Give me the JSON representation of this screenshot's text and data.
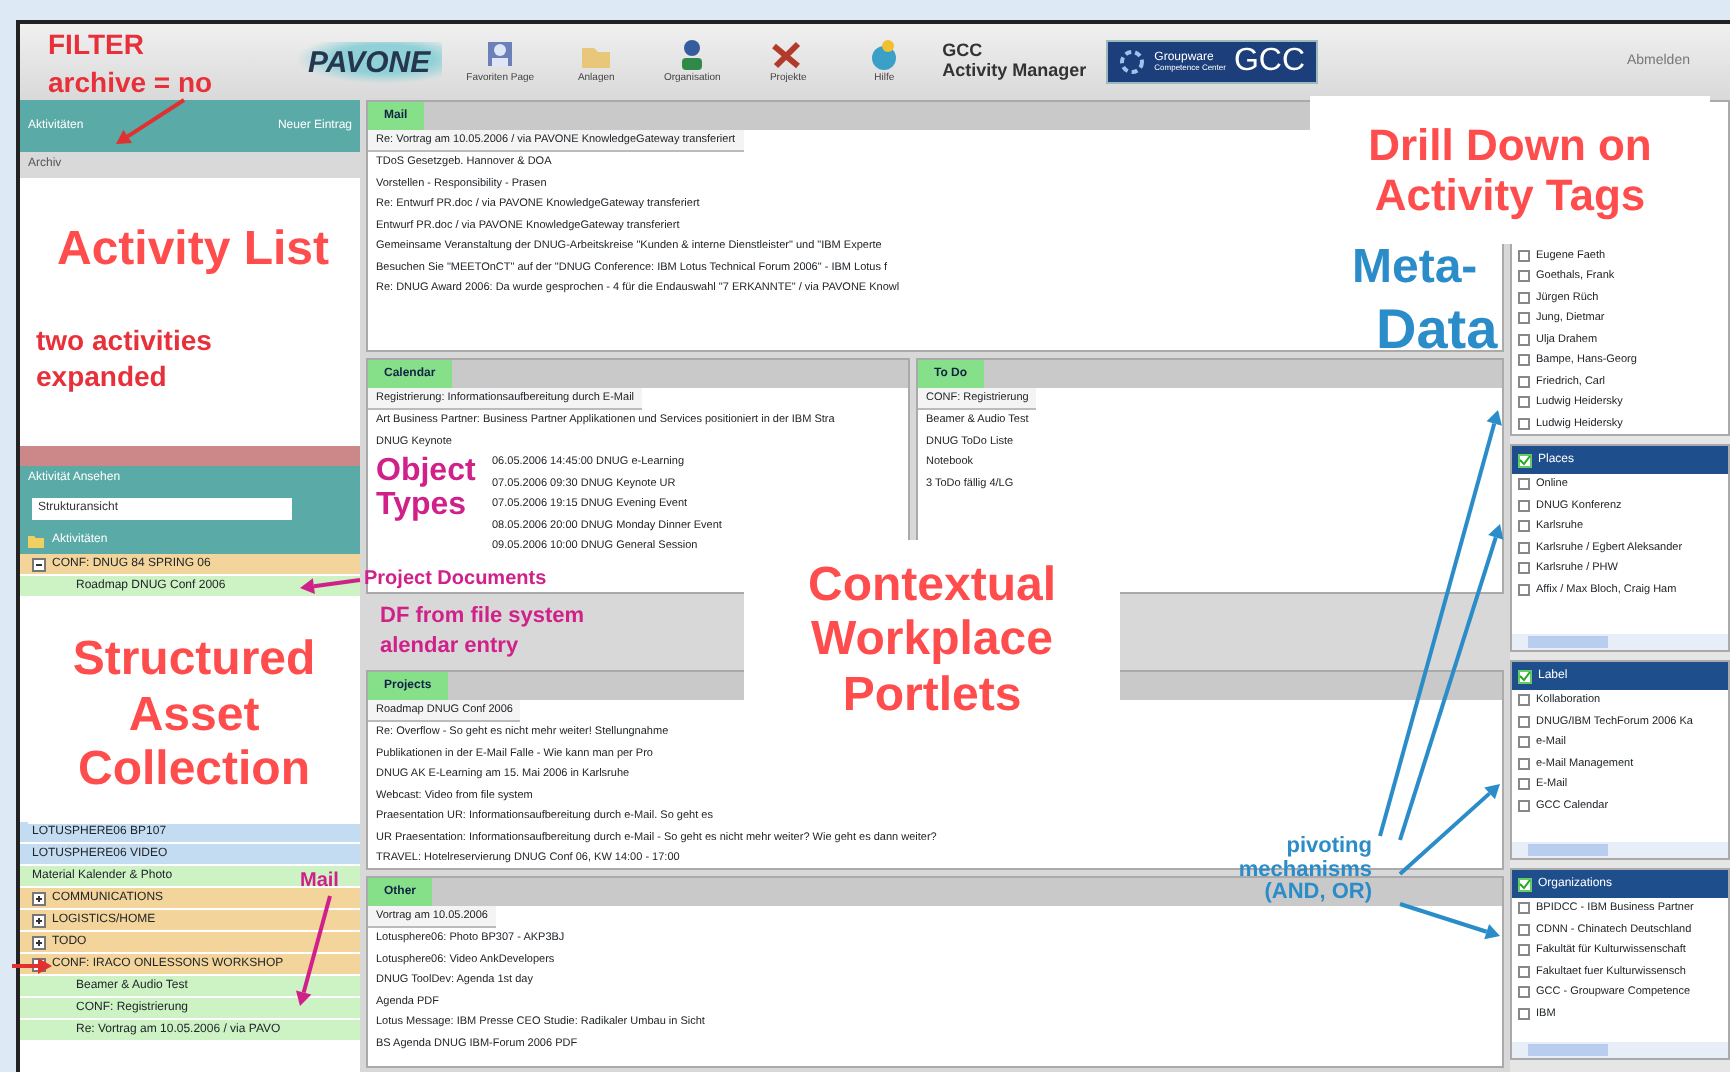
{
  "header": {
    "logo": "PAVONE",
    "toolbar": [
      {
        "label": "Favoriten Page"
      },
      {
        "label": "Anlagen"
      },
      {
        "label": "Organisation"
      },
      {
        "label": "Projekte"
      },
      {
        "label": "Hilfe"
      }
    ],
    "app_title": [
      "GCC",
      "Activity Manager"
    ],
    "banner": {
      "text": "Groupware",
      "sub": "Competence Center",
      "mark": "GCC"
    },
    "logout": "Abmelden"
  },
  "sidebar": {
    "list_header": "Aktivitäten",
    "list_action": "Neuer Eintrag",
    "filter": "Archiv",
    "view_header": "Aktivität Ansehen",
    "view_select": "Strukturansicht",
    "folder": "Aktivitäten",
    "tree": [
      {
        "text": "CONF: DNUG 84 SPRING 06",
        "color": "#f3d49a",
        "expanded": true,
        "children": [
          {
            "text": "Roadmap DNUG Conf 2006",
            "color": "#cdf2c4"
          }
        ]
      },
      {
        "text": "LOTUSPHERE06 BP107",
        "color": "#c4dcf2"
      },
      {
        "text": "LOTUSPHERE06 VIDEO",
        "color": "#c4dcf2"
      },
      {
        "text": "Material Kalender & Photo",
        "color": "#cdf2c4"
      },
      {
        "text": "COMMUNICATIONS",
        "color": "#f3d49a",
        "expanded": false
      },
      {
        "text": "LOGISTICS/HOME",
        "color": "#f3d49a",
        "expanded": false
      },
      {
        "text": "TODO",
        "color": "#f3d49a",
        "expanded": false
      },
      {
        "text": "CONF: IRACO ONLESSONS WORKSHOP",
        "color": "#f3d49a",
        "expanded": true,
        "children": [
          {
            "text": "Beamer & Audio Test",
            "color": "#cdf2c4"
          },
          {
            "text": "CONF: Registrierung",
            "color": "#cdf2c4"
          },
          {
            "text": "Re: Vortrag am 10.05.2006 / via PAVO",
            "color": "#cdf2c4"
          }
        ]
      }
    ]
  },
  "portlets": [
    {
      "title": "Mail",
      "subtitle": "Re: Vortrag am 10.05.2006 / via PAVONE KnowledgeGateway transferiert",
      "lines": [
        "TDoS Gesetzgeb. Hannover & DOA",
        "Vorstellen - Responsibility - Prasen",
        "Re: Entwurf PR.doc / via PAVONE KnowledgeGateway transferiert",
        "Entwurf PR.doc / via PAVONE KnowledgeGateway transferiert",
        "Gemeinsame Veranstaltung der DNUG-Arbeitskreise \"Kunden & interne Dienstleister\" und \"IBM Experte",
        "Besuchen Sie \"MEETOnCT\" auf der \"DNUG Conference: IBM Lotus Technical Forum 2006\" - IBM Lotus f",
        "Re: DNUG Award 2006: Da wurde gesprochen - 4 für die Endauswahl \"7 ERKANNTE\" / via PAVONE Knowl"
      ]
    },
    {
      "title": "Calendar",
      "subtitle": "Registrierung: Informationsaufbereitung durch E-Mail",
      "lines": [
        "Art Business Partner: Business Partner Applikationen und Services positioniert in der IBM Stra",
        "DNUG Keynote",
        "06.05.2006 14:45:00 DNUG e-Learning",
        "07.05.2006 09:30 DNUG Keynote UR",
        "07.05.2006 19:15 DNUG Evening Event",
        "08.05.2006 20:00 DNUG Monday Dinner Event",
        "09.05.2006 10:00 DNUG General Session"
      ]
    },
    {
      "title": "To Do",
      "subtitle": "CONF: Registrierung",
      "lines": [
        "Beamer & Audio Test",
        "DNUG ToDo Liste",
        "Notebook",
        "3 ToDo fällig 4/LG"
      ]
    },
    {
      "title": "Projects",
      "subtitle": "Roadmap DNUG Conf 2006",
      "lines": [
        "Re: Overflow - So geht es nicht mehr weiter! Stellungnahme",
        "Publikationen in der E-Mail Falle - Wie kann man per Pro",
        "DNUG AK E-Learning am 15. Mai 2006 in Karlsruhe",
        "Webcast: Video from file system",
        "Praesentation UR: Informationsaufbereitung durch e-Mail. So geht es",
        "UR Praesentation: Informationsaufbereitung durch e-Mail - So geht es nicht mehr weiter? Wie geht es dann weiter?",
        "TRAVEL: Hotelreservierung DNUG Conf 06, KW 14:00 - 17:00"
      ]
    },
    {
      "title": "Other",
      "subtitle": "Vortrag am 10.05.2006",
      "lines": [
        "Lotusphere06: Photo BP307 - AKP3BJ",
        "Lotusphere06: Video AnkDevelopers",
        "DNUG ToolDev: Agenda 1st day",
        "Agenda PDF",
        "Lotus Message: IBM Presse CEO Studie: Radikaler Umbau in Sicht",
        "BS Agenda DNUG IBM-Forum 2006 PDF"
      ]
    }
  ],
  "tag_panels": [
    {
      "items": [
        {
          "text": "Eugene Faeth",
          "checked": false
        },
        {
          "text": "Goethals, Frank",
          "checked": false
        },
        {
          "text": "Jürgen Rüch",
          "checked": false
        },
        {
          "text": "Jung, Dietmar",
          "checked": false
        },
        {
          "text": "Ulja Drahem",
          "checked": false
        },
        {
          "text": "Bampe, Hans-Georg",
          "checked": false
        },
        {
          "text": "Friedrich, Carl",
          "checked": false
        },
        {
          "text": "Ludwig Heidersky",
          "checked": false
        },
        {
          "text": "Ludwig Heidersky",
          "checked": false
        }
      ]
    },
    {
      "title": "Places",
      "items": [
        {
          "text": "Online",
          "checked": false
        },
        {
          "text": "DNUG Konferenz",
          "checked": false
        },
        {
          "text": "Karlsruhe",
          "checked": false
        },
        {
          "text": "Karlsruhe / Egbert Aleksander",
          "checked": false
        },
        {
          "text": "Karlsruhe / PHW",
          "checked": false
        },
        {
          "text": "Affix / Max Bloch, Craig Ham",
          "checked": false
        }
      ]
    },
    {
      "title": "Label",
      "items": [
        {
          "text": "Kollaboration",
          "checked": false
        },
        {
          "text": "DNUG/IBM TechForum 2006 Ka",
          "checked": false
        },
        {
          "text": "e-Mail",
          "checked": false
        },
        {
          "text": "e-Mail Management",
          "checked": false
        },
        {
          "text": "E-Mail",
          "checked": false
        },
        {
          "text": "GCC Calendar",
          "checked": false
        }
      ]
    },
    {
      "title": "Organizations",
      "items": [
        {
          "text": "BPIDCC - IBM Business Partner",
          "checked": false
        },
        {
          "text": "CDNN - Chinatech Deutschland",
          "checked": false
        },
        {
          "text": "Fakultät für Kulturwissenschaft",
          "checked": false
        },
        {
          "text": "Fakultaet fuer Kulturwissensch",
          "checked": false
        },
        {
          "text": "GCC - Groupware Competence",
          "checked": false
        },
        {
          "text": "IBM",
          "checked": false
        }
      ]
    }
  ],
  "annotations": [
    {
      "kind": "note",
      "color": "#e8303a",
      "text": "FILTER"
    },
    {
      "kind": "note",
      "color": "#e8303a",
      "text": "archive = no"
    },
    {
      "kind": "callout",
      "color": "#ff4d4d",
      "text": "Activity List"
    },
    {
      "kind": "note",
      "color": "#e8303a",
      "text": "two activities"
    },
    {
      "kind": "note",
      "color": "#e8303a",
      "text": "expanded"
    },
    {
      "kind": "note",
      "color": "#d0208a",
      "text": "Object Types"
    },
    {
      "kind": "note",
      "color": "#d0208a",
      "text": "Project Documents"
    },
    {
      "kind": "callout",
      "color": "#ff4d4d",
      "text": "Structured Asset Collection"
    },
    {
      "kind": "note",
      "color": "#d0208a",
      "text": "DF from file system"
    },
    {
      "kind": "note",
      "color": "#d0208a",
      "text": "alendar entry"
    },
    {
      "kind": "callout",
      "color": "#ff4d4d",
      "text": "Contextual Workplace Portlets"
    },
    {
      "kind": "note",
      "color": "#d0208a",
      "text": "Mail"
    },
    {
      "kind": "callout",
      "color": "#ff4d4d",
      "text": "Drill Down on Activity Tags"
    },
    {
      "kind": "headline",
      "color": "#2a8cc8",
      "text": "Meta-"
    },
    {
      "kind": "headline",
      "color": "#2a8cc8",
      "text": "Data"
    },
    {
      "kind": "note",
      "color": "#2a8cc8",
      "text": "pivoting mechanisms (AND, OR)"
    }
  ]
}
